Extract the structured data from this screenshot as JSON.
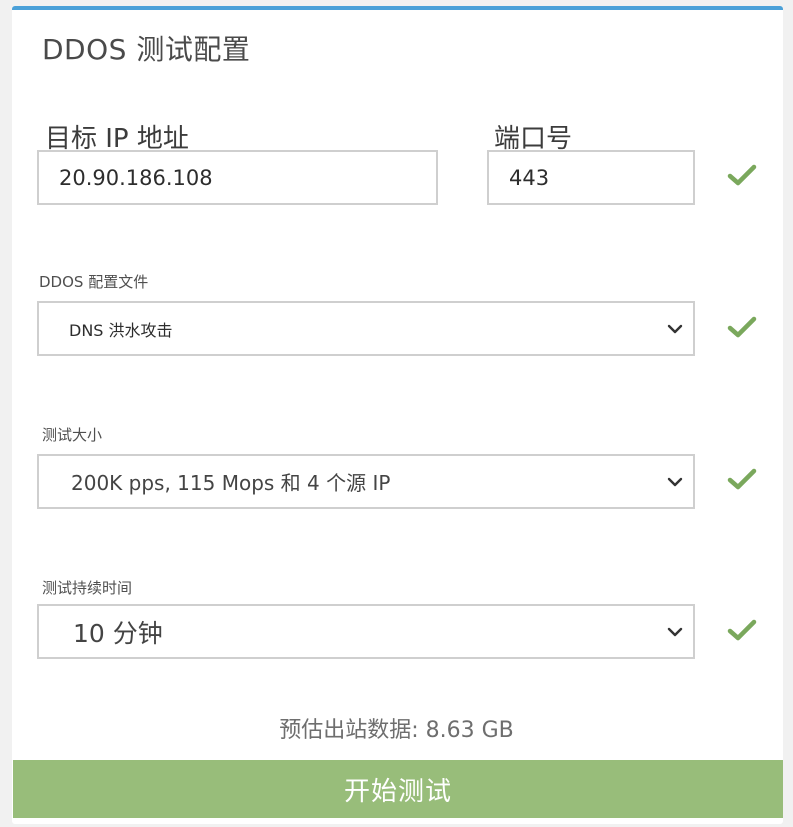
{
  "form": {
    "title": "DDOS 测试配置",
    "target_ip": {
      "label": "目标 IP 地址",
      "value": "20.90.186.108"
    },
    "port": {
      "label": "端口号",
      "value": "443"
    },
    "profile": {
      "label": "DDOS 配置文件",
      "value": "DNS 洪水攻击"
    },
    "test_size": {
      "label": "测试大小",
      "value": "200K pps, 115 Mops 和 4 个源 IP"
    },
    "duration": {
      "label": "测试持续时间",
      "value": "10 分钟"
    },
    "estimate": "预估出站数据: 8.63 GB",
    "start_label": "开始测试"
  },
  "colors": {
    "accent": "#4aa0d8",
    "check": "#7aa85c",
    "button": "#98bd7a"
  },
  "icons": {
    "valid": "check-icon",
    "dropdown": "chevron-down-icon"
  }
}
